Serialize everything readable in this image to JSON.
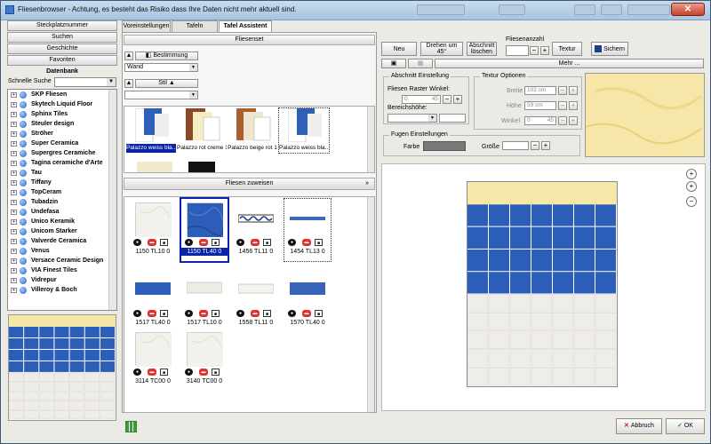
{
  "window": {
    "title": "Fliesenbrowser - Achtung, es besteht das Risiko dass Ihre Daten nicht mehr aktuell sind.",
    "close_label": "✕"
  },
  "left": {
    "nav": [
      "Steckplatznummer",
      "Suchen",
      "Geschichte",
      "Favoriten"
    ],
    "db_header": "Datenbank",
    "quick_search_label": "Schnelle Suche",
    "quick_search_value": "",
    "manufacturers": [
      "SKP Fliesen",
      "Skytech Liquid Floor",
      "Sphinx Tiles",
      "Steuler design",
      "Ströher",
      "Super Ceramica",
      "Supergres Ceramiche",
      "Tagina ceramiche d'Arte",
      "Tau",
      "Tiffany",
      "TopCeram",
      "Tubadzin",
      "Undefasa",
      "Unico Keramik",
      "Unicom Starker",
      "Valverde Ceramica",
      "Venus",
      "Versace Ceramic Design",
      "VIA Finest Tiles",
      "Vidrepur",
      "Villeroy & Boch"
    ]
  },
  "tabs": [
    "Voreinstellungen",
    "Tafeln",
    "Tafel Assistent"
  ],
  "active_tab": "Tafel Assistent",
  "mid": {
    "fliesenset_label": "Fliesenset",
    "bestimmung_label": "Bestimmung",
    "bestimmung_value": "Wand",
    "stil_label": "Stil",
    "stil_value": "",
    "sets": [
      "Palazzo weiss bla...",
      "Palazzo rot creme 1",
      "Palazzo beige rot 1",
      "Palazzo weiss bla..."
    ],
    "zuweisen_label": "Fliesen zuweisen",
    "zuweisen_arrow": "»",
    "tiles": [
      {
        "code": "1150 TL10 0",
        "style": "marble"
      },
      {
        "code": "1150 TL40 0",
        "style": "blue"
      },
      {
        "code": "1456 TL11 0",
        "style": "border-wave"
      },
      {
        "code": "1454 TL13 0",
        "style": "border-thin"
      },
      {
        "code": "1517 TL40 0",
        "style": "strip-blue"
      },
      {
        "code": "1517 TL10 0",
        "style": "strip-white"
      },
      {
        "code": "1558 TL11 0",
        "style": "strip-white2"
      },
      {
        "code": "1570 TL40 0",
        "style": "strip-blue2"
      },
      {
        "code": "3114 TC00 0",
        "style": "marble"
      },
      {
        "code": "3140 TC00 0",
        "style": "marble"
      }
    ]
  },
  "toolbar": {
    "neu": "Neu",
    "drehen": "Drehen um 45°",
    "abschnitt_loeschen": "Abschnitt löschen",
    "fliesenanzahl_label": "Fliesenanzahl",
    "fliesenanzahl_value": "",
    "textur": "Textur",
    "sichern": "Sichern",
    "mehr": "Mehr ..."
  },
  "abschnitt": {
    "group_label": "Abschnitt Einstellung",
    "raster_label": "Fliesen Raster Winkel:",
    "raster_value": "0",
    "raster_angle": "45",
    "bereich_label": "Bereichshöhe:"
  },
  "textur": {
    "group_label": "Textur Optionen",
    "breite_label": "Breite",
    "breite_value": "102 cm",
    "hoehe_label": "Höhe",
    "hoehe_value": "59 cm",
    "winkel_label": "Winkel",
    "winkel_value": "0",
    "winkel_angle": "45"
  },
  "fugen": {
    "group_label": "Fugen Einstellungen",
    "farbe_label": "Farbe",
    "groesse_label": "Größe",
    "color": "#7a7a7a"
  },
  "buttons": {
    "abbruch": "Abbruch",
    "ok": "OK"
  },
  "colors": {
    "selection": "#0a24a8",
    "blue_tile": "#2c5db8",
    "cream_tile": "#f6e6a7"
  }
}
